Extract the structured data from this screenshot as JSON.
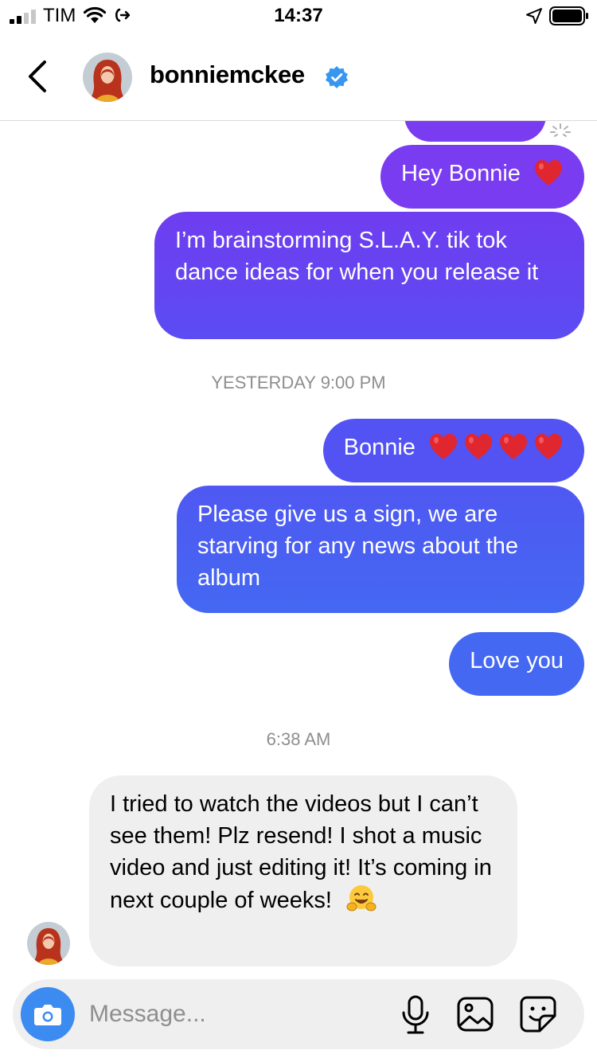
{
  "status_bar": {
    "carrier": "TIM",
    "time": "14:37",
    "icons": [
      "signal-icon",
      "wifi-icon",
      "call-forward-icon",
      "location-arrow-icon",
      "battery-icon"
    ]
  },
  "header": {
    "username": "bonniemckee",
    "verified": true,
    "icons": [
      "back-chevron-icon",
      "verified-badge-icon"
    ]
  },
  "colors": {
    "accent_blue": "#3c8bf0",
    "verified_blue": "#3797f0",
    "bubble_purple": "#7a3cf0",
    "bubble_blue": "#4468f2",
    "incoming_bubble": "#efefef"
  },
  "messages": [
    {
      "direction": "outgoing",
      "text": "Hey Bonnie",
      "emoji": [
        "heart-emoji"
      ]
    },
    {
      "direction": "outgoing",
      "text": "I’m brainstorming S.L.A.Y. tik tok dance ideas for when you release it"
    },
    {
      "type": "divider",
      "text": "YESTERDAY 9:00 PM"
    },
    {
      "direction": "outgoing",
      "text": "Bonnie",
      "emoji": [
        "heart-emoji",
        "heart-emoji",
        "heart-emoji",
        "heart-emoji"
      ]
    },
    {
      "direction": "outgoing",
      "text": "Please give us a sign, we are starving for any news about the album"
    },
    {
      "direction": "outgoing",
      "text": "Love you"
    },
    {
      "type": "divider",
      "text": "6:38 AM"
    },
    {
      "direction": "incoming",
      "text": "I tried to watch the videos but I can’t see them! Plz resend! I shot a music video and just editing it! It’s coming in next couple of weeks!",
      "emoji": [
        "hugging-face-emoji"
      ]
    }
  ],
  "composer": {
    "placeholder": "Message...",
    "icons": [
      "camera-icon",
      "microphone-icon",
      "gallery-icon",
      "sticker-icon"
    ]
  }
}
